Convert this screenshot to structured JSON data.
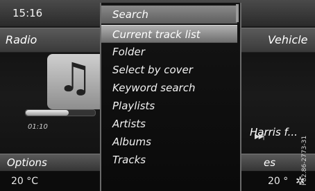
{
  "status": {
    "clock": "15:16"
  },
  "nav": {
    "left": "Radio",
    "right": "Vehicle"
  },
  "player": {
    "elapsed": "01:10",
    "progress": 0.62,
    "artist_partial": "Harris f...",
    "skip_icon": "skip-forward-icon",
    "note_icon": "music-note-icon"
  },
  "bottom": {
    "options": "Options",
    "right_partial": "es"
  },
  "footer": {
    "temp_left": "20 °C",
    "temp_right": "20 °"
  },
  "watermark": "P82.86-2773-31",
  "menu": {
    "items": [
      {
        "label": "Search",
        "state": "header"
      },
      {
        "label": "Current track list",
        "state": "selected"
      },
      {
        "label": "Folder",
        "state": "normal"
      },
      {
        "label": "Select by cover",
        "state": "normal"
      },
      {
        "label": "Keyword search",
        "state": "normal"
      },
      {
        "label": "Playlists",
        "state": "normal"
      },
      {
        "label": "Artists",
        "state": "normal"
      },
      {
        "label": "Albums",
        "state": "normal"
      },
      {
        "label": "Tracks",
        "state": "normal"
      }
    ]
  }
}
